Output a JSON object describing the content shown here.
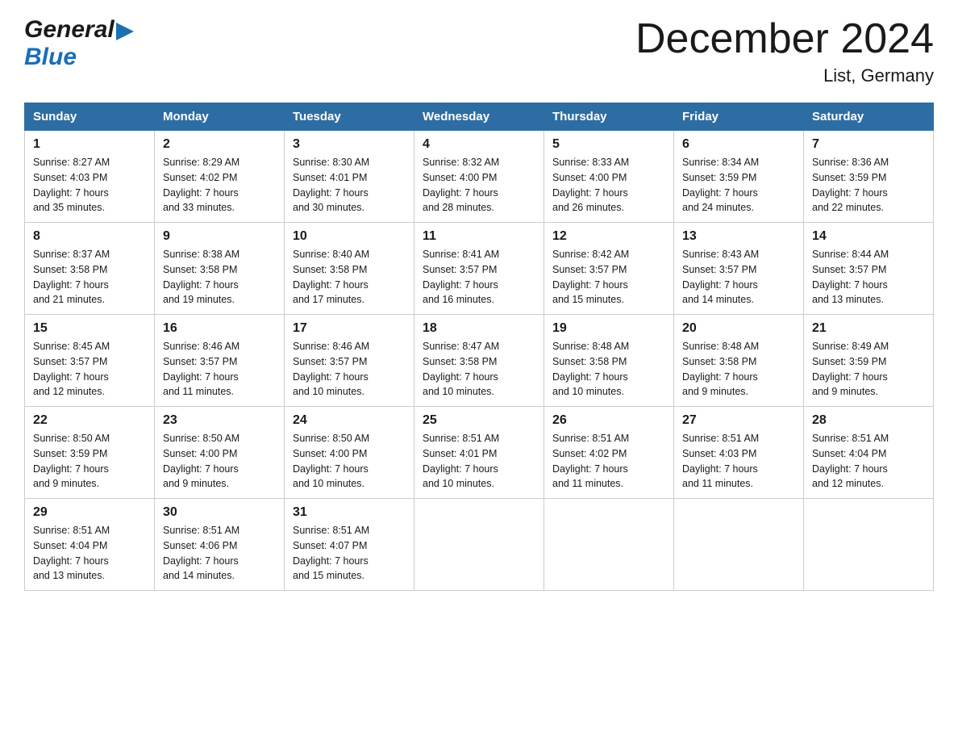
{
  "logo": {
    "general": "General",
    "blue": "Blue",
    "arrow": "▶"
  },
  "title": "December 2024",
  "subtitle": "List, Germany",
  "days_of_week": [
    "Sunday",
    "Monday",
    "Tuesday",
    "Wednesday",
    "Thursday",
    "Friday",
    "Saturday"
  ],
  "weeks": [
    [
      {
        "day": "1",
        "sunrise": "Sunrise: 8:27 AM",
        "sunset": "Sunset: 4:03 PM",
        "daylight": "Daylight: 7 hours",
        "daylight2": "and 35 minutes."
      },
      {
        "day": "2",
        "sunrise": "Sunrise: 8:29 AM",
        "sunset": "Sunset: 4:02 PM",
        "daylight": "Daylight: 7 hours",
        "daylight2": "and 33 minutes."
      },
      {
        "day": "3",
        "sunrise": "Sunrise: 8:30 AM",
        "sunset": "Sunset: 4:01 PM",
        "daylight": "Daylight: 7 hours",
        "daylight2": "and 30 minutes."
      },
      {
        "day": "4",
        "sunrise": "Sunrise: 8:32 AM",
        "sunset": "Sunset: 4:00 PM",
        "daylight": "Daylight: 7 hours",
        "daylight2": "and 28 minutes."
      },
      {
        "day": "5",
        "sunrise": "Sunrise: 8:33 AM",
        "sunset": "Sunset: 4:00 PM",
        "daylight": "Daylight: 7 hours",
        "daylight2": "and 26 minutes."
      },
      {
        "day": "6",
        "sunrise": "Sunrise: 8:34 AM",
        "sunset": "Sunset: 3:59 PM",
        "daylight": "Daylight: 7 hours",
        "daylight2": "and 24 minutes."
      },
      {
        "day": "7",
        "sunrise": "Sunrise: 8:36 AM",
        "sunset": "Sunset: 3:59 PM",
        "daylight": "Daylight: 7 hours",
        "daylight2": "and 22 minutes."
      }
    ],
    [
      {
        "day": "8",
        "sunrise": "Sunrise: 8:37 AM",
        "sunset": "Sunset: 3:58 PM",
        "daylight": "Daylight: 7 hours",
        "daylight2": "and 21 minutes."
      },
      {
        "day": "9",
        "sunrise": "Sunrise: 8:38 AM",
        "sunset": "Sunset: 3:58 PM",
        "daylight": "Daylight: 7 hours",
        "daylight2": "and 19 minutes."
      },
      {
        "day": "10",
        "sunrise": "Sunrise: 8:40 AM",
        "sunset": "Sunset: 3:58 PM",
        "daylight": "Daylight: 7 hours",
        "daylight2": "and 17 minutes."
      },
      {
        "day": "11",
        "sunrise": "Sunrise: 8:41 AM",
        "sunset": "Sunset: 3:57 PM",
        "daylight": "Daylight: 7 hours",
        "daylight2": "and 16 minutes."
      },
      {
        "day": "12",
        "sunrise": "Sunrise: 8:42 AM",
        "sunset": "Sunset: 3:57 PM",
        "daylight": "Daylight: 7 hours",
        "daylight2": "and 15 minutes."
      },
      {
        "day": "13",
        "sunrise": "Sunrise: 8:43 AM",
        "sunset": "Sunset: 3:57 PM",
        "daylight": "Daylight: 7 hours",
        "daylight2": "and 14 minutes."
      },
      {
        "day": "14",
        "sunrise": "Sunrise: 8:44 AM",
        "sunset": "Sunset: 3:57 PM",
        "daylight": "Daylight: 7 hours",
        "daylight2": "and 13 minutes."
      }
    ],
    [
      {
        "day": "15",
        "sunrise": "Sunrise: 8:45 AM",
        "sunset": "Sunset: 3:57 PM",
        "daylight": "Daylight: 7 hours",
        "daylight2": "and 12 minutes."
      },
      {
        "day": "16",
        "sunrise": "Sunrise: 8:46 AM",
        "sunset": "Sunset: 3:57 PM",
        "daylight": "Daylight: 7 hours",
        "daylight2": "and 11 minutes."
      },
      {
        "day": "17",
        "sunrise": "Sunrise: 8:46 AM",
        "sunset": "Sunset: 3:57 PM",
        "daylight": "Daylight: 7 hours",
        "daylight2": "and 10 minutes."
      },
      {
        "day": "18",
        "sunrise": "Sunrise: 8:47 AM",
        "sunset": "Sunset: 3:58 PM",
        "daylight": "Daylight: 7 hours",
        "daylight2": "and 10 minutes."
      },
      {
        "day": "19",
        "sunrise": "Sunrise: 8:48 AM",
        "sunset": "Sunset: 3:58 PM",
        "daylight": "Daylight: 7 hours",
        "daylight2": "and 10 minutes."
      },
      {
        "day": "20",
        "sunrise": "Sunrise: 8:48 AM",
        "sunset": "Sunset: 3:58 PM",
        "daylight": "Daylight: 7 hours",
        "daylight2": "and 9 minutes."
      },
      {
        "day": "21",
        "sunrise": "Sunrise: 8:49 AM",
        "sunset": "Sunset: 3:59 PM",
        "daylight": "Daylight: 7 hours",
        "daylight2": "and 9 minutes."
      }
    ],
    [
      {
        "day": "22",
        "sunrise": "Sunrise: 8:50 AM",
        "sunset": "Sunset: 3:59 PM",
        "daylight": "Daylight: 7 hours",
        "daylight2": "and 9 minutes."
      },
      {
        "day": "23",
        "sunrise": "Sunrise: 8:50 AM",
        "sunset": "Sunset: 4:00 PM",
        "daylight": "Daylight: 7 hours",
        "daylight2": "and 9 minutes."
      },
      {
        "day": "24",
        "sunrise": "Sunrise: 8:50 AM",
        "sunset": "Sunset: 4:00 PM",
        "daylight": "Daylight: 7 hours",
        "daylight2": "and 10 minutes."
      },
      {
        "day": "25",
        "sunrise": "Sunrise: 8:51 AM",
        "sunset": "Sunset: 4:01 PM",
        "daylight": "Daylight: 7 hours",
        "daylight2": "and 10 minutes."
      },
      {
        "day": "26",
        "sunrise": "Sunrise: 8:51 AM",
        "sunset": "Sunset: 4:02 PM",
        "daylight": "Daylight: 7 hours",
        "daylight2": "and 11 minutes."
      },
      {
        "day": "27",
        "sunrise": "Sunrise: 8:51 AM",
        "sunset": "Sunset: 4:03 PM",
        "daylight": "Daylight: 7 hours",
        "daylight2": "and 11 minutes."
      },
      {
        "day": "28",
        "sunrise": "Sunrise: 8:51 AM",
        "sunset": "Sunset: 4:04 PM",
        "daylight": "Daylight: 7 hours",
        "daylight2": "and 12 minutes."
      }
    ],
    [
      {
        "day": "29",
        "sunrise": "Sunrise: 8:51 AM",
        "sunset": "Sunset: 4:04 PM",
        "daylight": "Daylight: 7 hours",
        "daylight2": "and 13 minutes."
      },
      {
        "day": "30",
        "sunrise": "Sunrise: 8:51 AM",
        "sunset": "Sunset: 4:06 PM",
        "daylight": "Daylight: 7 hours",
        "daylight2": "and 14 minutes."
      },
      {
        "day": "31",
        "sunrise": "Sunrise: 8:51 AM",
        "sunset": "Sunset: 4:07 PM",
        "daylight": "Daylight: 7 hours",
        "daylight2": "and 15 minutes."
      },
      null,
      null,
      null,
      null
    ]
  ]
}
